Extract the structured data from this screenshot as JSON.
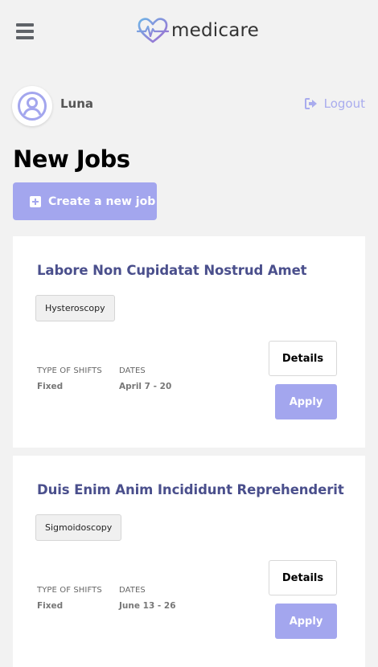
{
  "header": {
    "brand": "medicare",
    "menu_icon": "hamburger-menu-icon",
    "logo_icon": "heart-pulse-icon"
  },
  "user": {
    "name": "Luna",
    "avatar_icon": "user-avatar-icon",
    "logout_label": "Logout",
    "logout_icon": "logout-icon"
  },
  "page": {
    "title": "New Jobs",
    "create_label": "Create a new job",
    "create_icon": "plus-square-icon"
  },
  "colors": {
    "accent": "#a3a6ee",
    "title": "#4a4f8c",
    "logo_blue": "#6fb3e6",
    "logo_purple": "#a06ad0"
  },
  "jobs": [
    {
      "title": "Labore Non Cupidatat Nostrud Amet",
      "tag": "Hysteroscopy",
      "shift_label": "TYPE OF SHIFTS",
      "shift_value": "Fixed",
      "dates_label": "DATES",
      "dates_value": "April 7 - 20",
      "details_label": "Details",
      "apply_label": "Apply"
    },
    {
      "title": "Duis Enim Anim Incididunt Reprehenderit",
      "tag": "Sigmoidoscopy",
      "shift_label": "TYPE OF SHIFTS",
      "shift_value": "Fixed",
      "dates_label": "DATES",
      "dates_value": "June 13 - 26",
      "details_label": "Details",
      "apply_label": "Apply"
    }
  ]
}
